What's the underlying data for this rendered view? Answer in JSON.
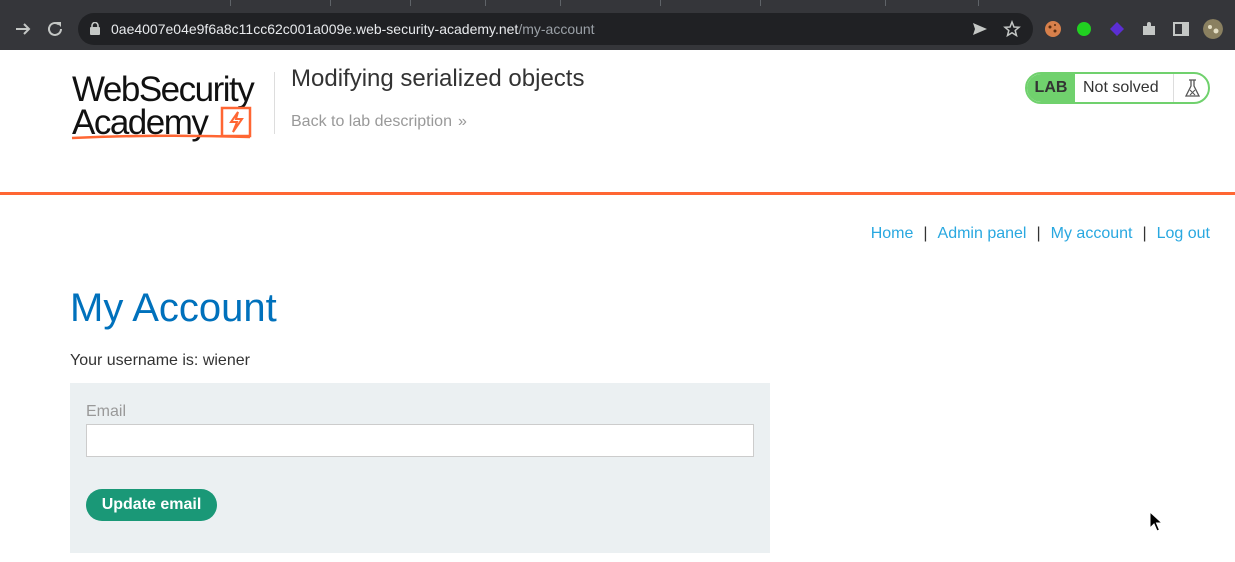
{
  "browser": {
    "url_host": "0ae4007e04e9f6a8c11cc62c001a009e.web-security-academy.net",
    "url_path": "/my-account",
    "back_icon": "arrow-right-icon",
    "reload_icon": "reload-icon",
    "extensions": [
      {
        "name": "cookie-extension-icon",
        "color": "#d7804b"
      },
      {
        "name": "green-extension-icon",
        "color": "#21d121"
      },
      {
        "name": "purple-extension-icon",
        "color": "#5b2ed3"
      },
      {
        "name": "puzzle-extensions-icon",
        "color": "#c4c7c5"
      }
    ]
  },
  "lab": {
    "logo_line1": "WebSecurity",
    "logo_line2": "Academy",
    "title": "Modifying serialized objects",
    "back_link": "Back to lab description",
    "badge": "LAB",
    "status": "Not solved"
  },
  "nav": {
    "home": "Home",
    "admin_panel": "Admin panel",
    "my_account": "My account",
    "log_out": "Log out",
    "separator": "|"
  },
  "account": {
    "title": "My Account",
    "username_line": "Your username is: wiener",
    "email_label": "Email",
    "email_value": "",
    "update_button": "Update email"
  },
  "colors": {
    "accent_orange": "#ff6633",
    "title_blue": "#0071bc",
    "link_blue": "#29a8e0",
    "button_green": "#1a9877",
    "lab_green": "#70d16d"
  }
}
